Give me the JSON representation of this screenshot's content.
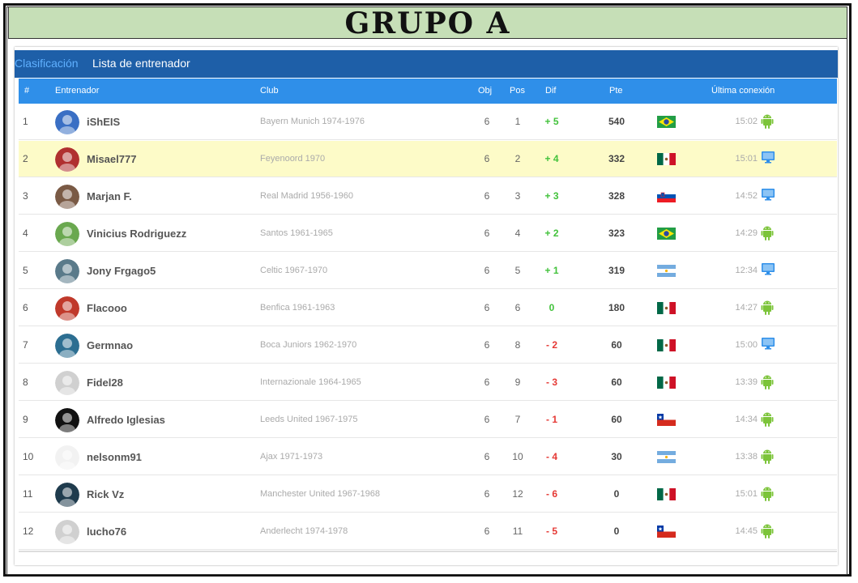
{
  "title": "GRUPO A",
  "tabs": {
    "active": "Clasificación",
    "other": "Lista de entrenador"
  },
  "columns": {
    "num": "#",
    "coach": "Entrenador",
    "club": "Club",
    "obj": "Obj",
    "pos": "Pos",
    "dif": "Dif",
    "pte": "Pte",
    "last": "Última conexión"
  },
  "rows": [
    {
      "num": "1",
      "name": "iShEIS",
      "club": "Bayern Munich 1974-1976",
      "obj": "6",
      "pos": "1",
      "dif": "+ 5",
      "pte": "540",
      "flag": "brazil",
      "time": "15:02",
      "device": "android-icon"
    },
    {
      "num": "2",
      "name": "Misael777",
      "club": "Feyenoord 1970",
      "obj": "6",
      "pos": "2",
      "dif": "+ 4",
      "pte": "332",
      "flag": "mexico",
      "time": "15:01",
      "device": "monitor-icon"
    },
    {
      "num": "3",
      "name": "Marjan F.",
      "club": "Real Madrid 1956-1960",
      "obj": "6",
      "pos": "3",
      "dif": "+ 3",
      "pte": "328",
      "flag": "slovenia",
      "time": "14:52",
      "device": "monitor-icon"
    },
    {
      "num": "4",
      "name": "Vinicius Rodriguezz",
      "club": "Santos 1961-1965",
      "obj": "6",
      "pos": "4",
      "dif": "+ 2",
      "pte": "323",
      "flag": "brazil",
      "time": "14:29",
      "device": "android-icon"
    },
    {
      "num": "5",
      "name": "Jony Frgago5",
      "club": "Celtic 1967-1970",
      "obj": "6",
      "pos": "5",
      "dif": "+ 1",
      "pte": "319",
      "flag": "argentina",
      "time": "12:34",
      "device": "monitor-icon"
    },
    {
      "num": "6",
      "name": "Flacooo",
      "club": "Benfica 1961-1963",
      "obj": "6",
      "pos": "6",
      "dif": "0",
      "pte": "180",
      "flag": "mexico",
      "time": "14:27",
      "device": "android-icon"
    },
    {
      "num": "7",
      "name": "Germnao",
      "club": "Boca Juniors 1962-1970",
      "obj": "6",
      "pos": "8",
      "dif": "- 2",
      "pte": "60",
      "flag": "mexico",
      "time": "15:00",
      "device": "monitor-icon"
    },
    {
      "num": "8",
      "name": "Fidel28",
      "club": "Internazionale 1964-1965",
      "obj": "6",
      "pos": "9",
      "dif": "- 3",
      "pte": "60",
      "flag": "mexico",
      "time": "13:39",
      "device": "android-icon"
    },
    {
      "num": "9",
      "name": "Alfredo Iglesias",
      "club": "Leeds United 1967-1975",
      "obj": "6",
      "pos": "7",
      "dif": "- 1",
      "pte": "60",
      "flag": "chile",
      "time": "14:34",
      "device": "android-icon"
    },
    {
      "num": "10",
      "name": "nelsonm91",
      "club": "Ajax 1971-1973",
      "obj": "6",
      "pos": "10",
      "dif": "- 4",
      "pte": "30",
      "flag": "argentina",
      "time": "13:38",
      "device": "android-icon"
    },
    {
      "num": "11",
      "name": "Rick Vz",
      "club": "Manchester United 1967-1968",
      "obj": "6",
      "pos": "12",
      "dif": "- 6",
      "pte": "0",
      "flag": "mexico",
      "time": "15:01",
      "device": "android-icon"
    },
    {
      "num": "12",
      "name": "lucho76",
      "club": "Anderlecht 1974-1978",
      "obj": "6",
      "pos": "11",
      "dif": "- 5",
      "pte": "0",
      "flag": "chile",
      "time": "14:45",
      "device": "android-icon"
    }
  ],
  "colors": {
    "header": "#1e5fa8",
    "subheader": "#2f8fe9",
    "highlight": "#fdfbc8",
    "positive": "#42c23b",
    "negative": "#e53935",
    "title_bg": "#c6dfb7"
  }
}
